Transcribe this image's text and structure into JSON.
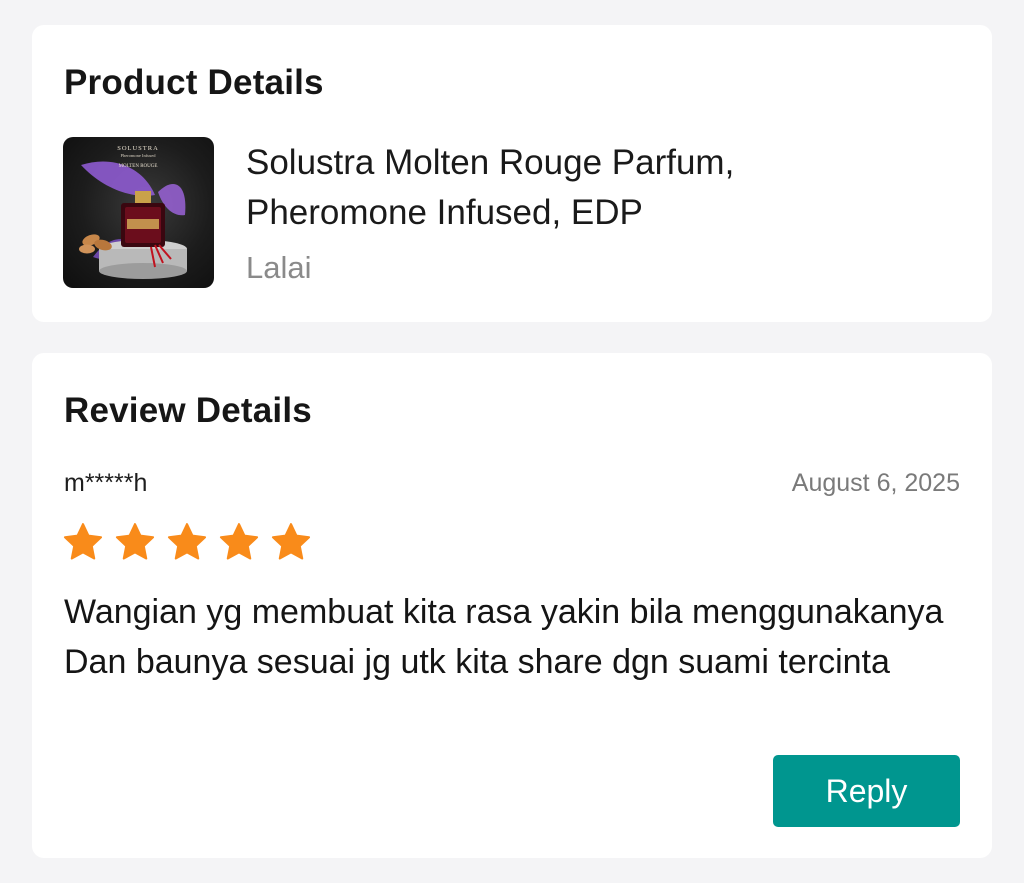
{
  "product_card": {
    "title": "Product Details",
    "product_name": "Solustra Molten Rouge Parfum, Pheromone Infused, EDP",
    "shop_name": "Lalai",
    "thumbnail": {
      "icon": "perfume-bottle-product-photo",
      "brand_text": "SOLUSTRA",
      "subtitle_text": "Pheromone Infused",
      "variant_text": "MOLTEN ROUGE"
    }
  },
  "review_card": {
    "title": "Review Details",
    "reviewer": "m*****h",
    "date": "August 6, 2025",
    "rating": 5,
    "rating_max": 5,
    "star_color": "#f98b1a",
    "review_text": "Wangian yg membuat kita rasa yakin bila menggunakanya Dan baunya sesuai jg utk kita share dgn suami tercinta",
    "reply_label": "Reply",
    "reply_color": "#00968f"
  }
}
